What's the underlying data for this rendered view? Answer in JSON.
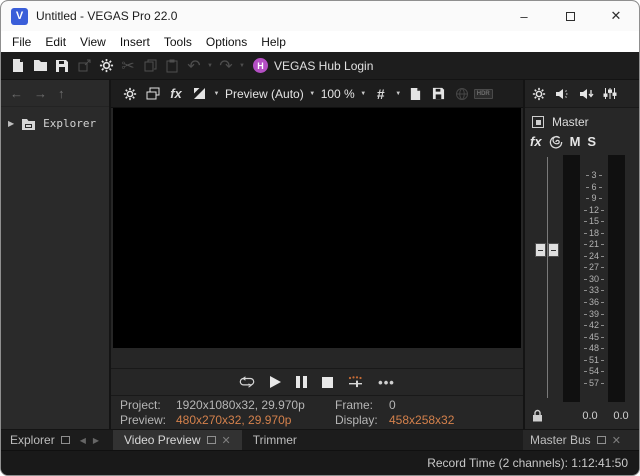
{
  "window": {
    "title": "Untitled - VEGAS Pro 22.0",
    "app_letter": "V",
    "controls": {
      "minimize": "–",
      "close": "✕"
    }
  },
  "menu": {
    "items": [
      "File",
      "Edit",
      "View",
      "Insert",
      "Tools",
      "Options",
      "Help"
    ]
  },
  "toolbar": {
    "hub_label": "VEGAS Hub Login",
    "hub_letter": "H"
  },
  "explorer": {
    "tree_label": "Explorer",
    "tab_label": "Explorer"
  },
  "preview_toolbar": {
    "fx_label": "fx",
    "quality": "Preview (Auto)",
    "zoom": "100 %",
    "grid_glyph": "#",
    "hdr_label": "HDR"
  },
  "info": {
    "project_label": "Project:",
    "project_value": "1920x1080x32, 29.970p",
    "frame_label": "Frame:",
    "frame_value": "0",
    "preview_label": "Preview:",
    "preview_value": "480x270x32, 29.970p",
    "display_label": "Display:",
    "display_value": "458x258x32"
  },
  "tabs": {
    "video_preview": "Video Preview",
    "trimmer": "Trimmer",
    "master_bus": "Master Bus"
  },
  "master": {
    "name": "Master",
    "fx_label": "fx",
    "mute": "M",
    "solo": "S",
    "scale": [
      "3",
      "6",
      "9",
      "12",
      "15",
      "18",
      "21",
      "24",
      "27",
      "30",
      "33",
      "36",
      "39",
      "42",
      "45",
      "48",
      "51",
      "54",
      "57"
    ],
    "left_db": "0.0",
    "right_db": "0.0"
  },
  "status": {
    "record_time": "Record Time (2 channels): 1:12:41:50"
  },
  "colors": {
    "accent_orange": "#d4814c",
    "hub_purple": "#b44fc4",
    "app_blue": "#3a5ed9",
    "meter_bg": "#101010"
  }
}
